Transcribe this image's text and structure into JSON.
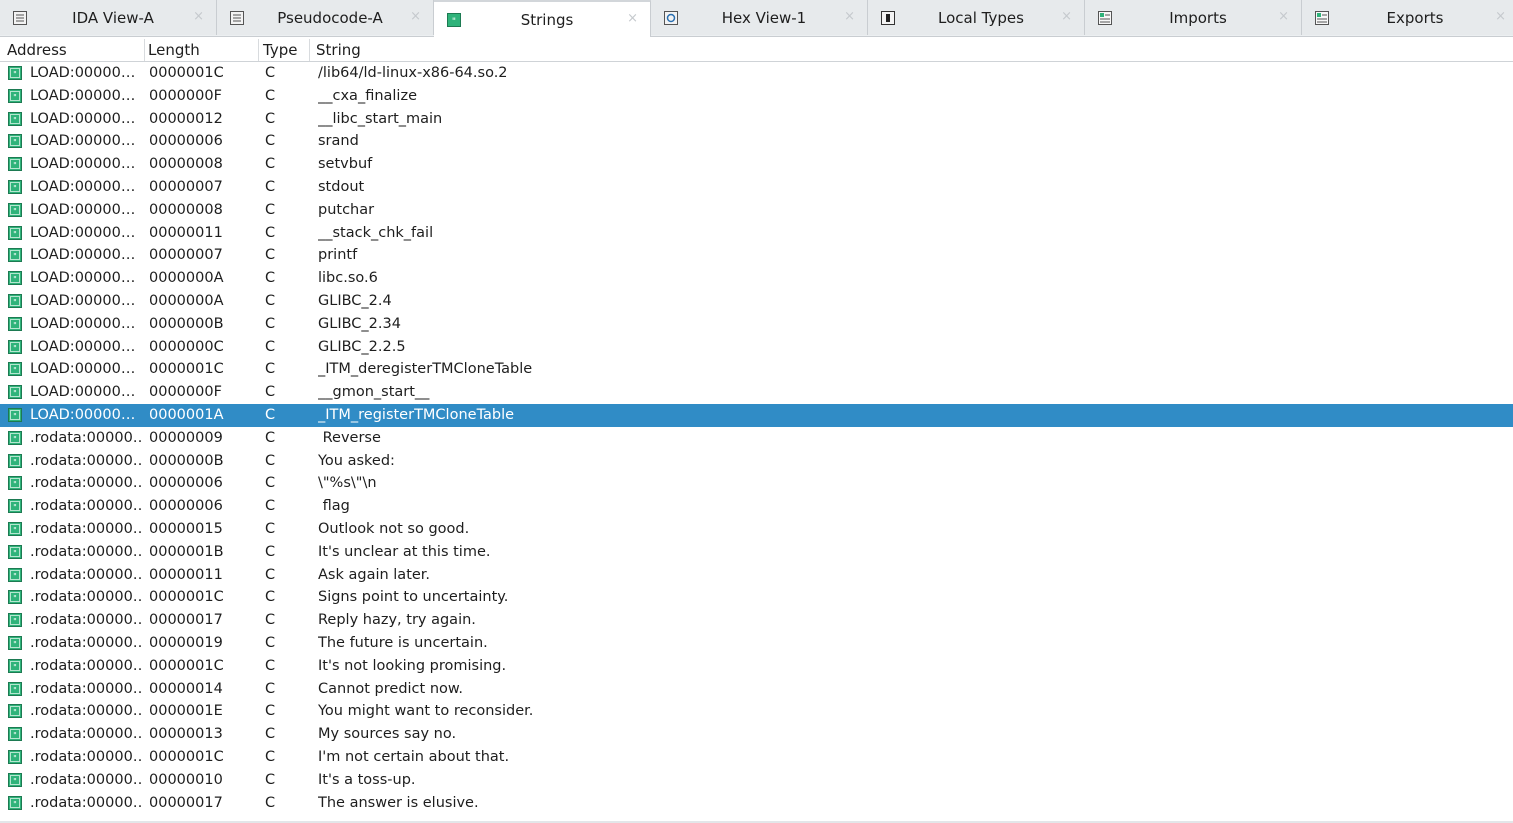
{
  "tabs": [
    {
      "label": "IDA View-A",
      "icon": "ida-view-icon",
      "active": false
    },
    {
      "label": "Pseudocode-A",
      "icon": "pseudocode-icon",
      "active": false
    },
    {
      "label": "Strings",
      "icon": "strings-icon",
      "active": true
    },
    {
      "label": "Hex View-1",
      "icon": "hex-view-icon",
      "active": false
    },
    {
      "label": "Local Types",
      "icon": "local-types-icon",
      "active": false
    },
    {
      "label": "Imports",
      "icon": "imports-icon",
      "active": false
    },
    {
      "label": "Exports",
      "icon": "exports-icon",
      "active": false
    }
  ],
  "tab_close_glyph": "×",
  "columns": {
    "address": "Address",
    "length": "Length",
    "type": "Type",
    "string": "String"
  },
  "rows": [
    {
      "address": "LOAD:00000…",
      "length": "0000001C",
      "type": "C",
      "string": "/lib64/ld-linux-x86-64.so.2"
    },
    {
      "address": "LOAD:00000…",
      "length": "0000000F",
      "type": "C",
      "string": "__cxa_finalize"
    },
    {
      "address": "LOAD:00000…",
      "length": "00000012",
      "type": "C",
      "string": "__libc_start_main"
    },
    {
      "address": "LOAD:00000…",
      "length": "00000006",
      "type": "C",
      "string": "srand"
    },
    {
      "address": "LOAD:00000…",
      "length": "00000008",
      "type": "C",
      "string": "setvbuf"
    },
    {
      "address": "LOAD:00000…",
      "length": "00000007",
      "type": "C",
      "string": "stdout"
    },
    {
      "address": "LOAD:00000…",
      "length": "00000008",
      "type": "C",
      "string": "putchar"
    },
    {
      "address": "LOAD:00000…",
      "length": "00000011",
      "type": "C",
      "string": "__stack_chk_fail"
    },
    {
      "address": "LOAD:00000…",
      "length": "00000007",
      "type": "C",
      "string": "printf"
    },
    {
      "address": "LOAD:00000…",
      "length": "0000000A",
      "type": "C",
      "string": "libc.so.6"
    },
    {
      "address": "LOAD:00000…",
      "length": "0000000A",
      "type": "C",
      "string": "GLIBC_2.4"
    },
    {
      "address": "LOAD:00000…",
      "length": "0000000B",
      "type": "C",
      "string": "GLIBC_2.34"
    },
    {
      "address": "LOAD:00000…",
      "length": "0000000C",
      "type": "C",
      "string": "GLIBC_2.2.5"
    },
    {
      "address": "LOAD:00000…",
      "length": "0000001C",
      "type": "C",
      "string": "_ITM_deregisterTMCloneTable"
    },
    {
      "address": "LOAD:00000…",
      "length": "0000000F",
      "type": "C",
      "string": "__gmon_start__"
    },
    {
      "address": "LOAD:00000…",
      "length": "0000001A",
      "type": "C",
      "string": "_ITM_registerTMCloneTable",
      "selected": true
    },
    {
      "address": ".rodata:00000…",
      "length": "00000009",
      "type": "C",
      "string": " Reverse"
    },
    {
      "address": ".rodata:00000…",
      "length": "0000000B",
      "type": "C",
      "string": "You asked:"
    },
    {
      "address": ".rodata:00000…",
      "length": "00000006",
      "type": "C",
      "string": "\\\"%s\\\"\\n"
    },
    {
      "address": ".rodata:00000…",
      "length": "00000006",
      "type": "C",
      "string": " flag"
    },
    {
      "address": ".rodata:00000…",
      "length": "00000015",
      "type": "C",
      "string": "Outlook not so good."
    },
    {
      "address": ".rodata:00000…",
      "length": "0000001B",
      "type": "C",
      "string": "It's unclear at this time."
    },
    {
      "address": ".rodata:00000…",
      "length": "00000011",
      "type": "C",
      "string": "Ask again later."
    },
    {
      "address": ".rodata:00000…",
      "length": "0000001C",
      "type": "C",
      "string": "Signs point to uncertainty."
    },
    {
      "address": ".rodata:00000…",
      "length": "00000017",
      "type": "C",
      "string": "Reply hazy, try again."
    },
    {
      "address": ".rodata:00000…",
      "length": "00000019",
      "type": "C",
      "string": "The future is uncertain."
    },
    {
      "address": ".rodata:00000…",
      "length": "0000001C",
      "type": "C",
      "string": "It's not looking promising."
    },
    {
      "address": ".rodata:00000…",
      "length": "00000014",
      "type": "C",
      "string": "Cannot predict now."
    },
    {
      "address": ".rodata:00000…",
      "length": "0000001E",
      "type": "C",
      "string": "You might want to reconsider."
    },
    {
      "address": ".rodata:00000…",
      "length": "00000013",
      "type": "C",
      "string": "My sources say no."
    },
    {
      "address": ".rodata:00000…",
      "length": "0000001C",
      "type": "C",
      "string": "I'm not certain about that."
    },
    {
      "address": ".rodata:00000…",
      "length": "00000010",
      "type": "C",
      "string": "It's a toss-up."
    },
    {
      "address": ".rodata:00000…",
      "length": "00000017",
      "type": "C",
      "string": "The answer is elusive."
    }
  ],
  "colors": {
    "selection": "#308cc6",
    "string_icon": "#2fb37a"
  }
}
